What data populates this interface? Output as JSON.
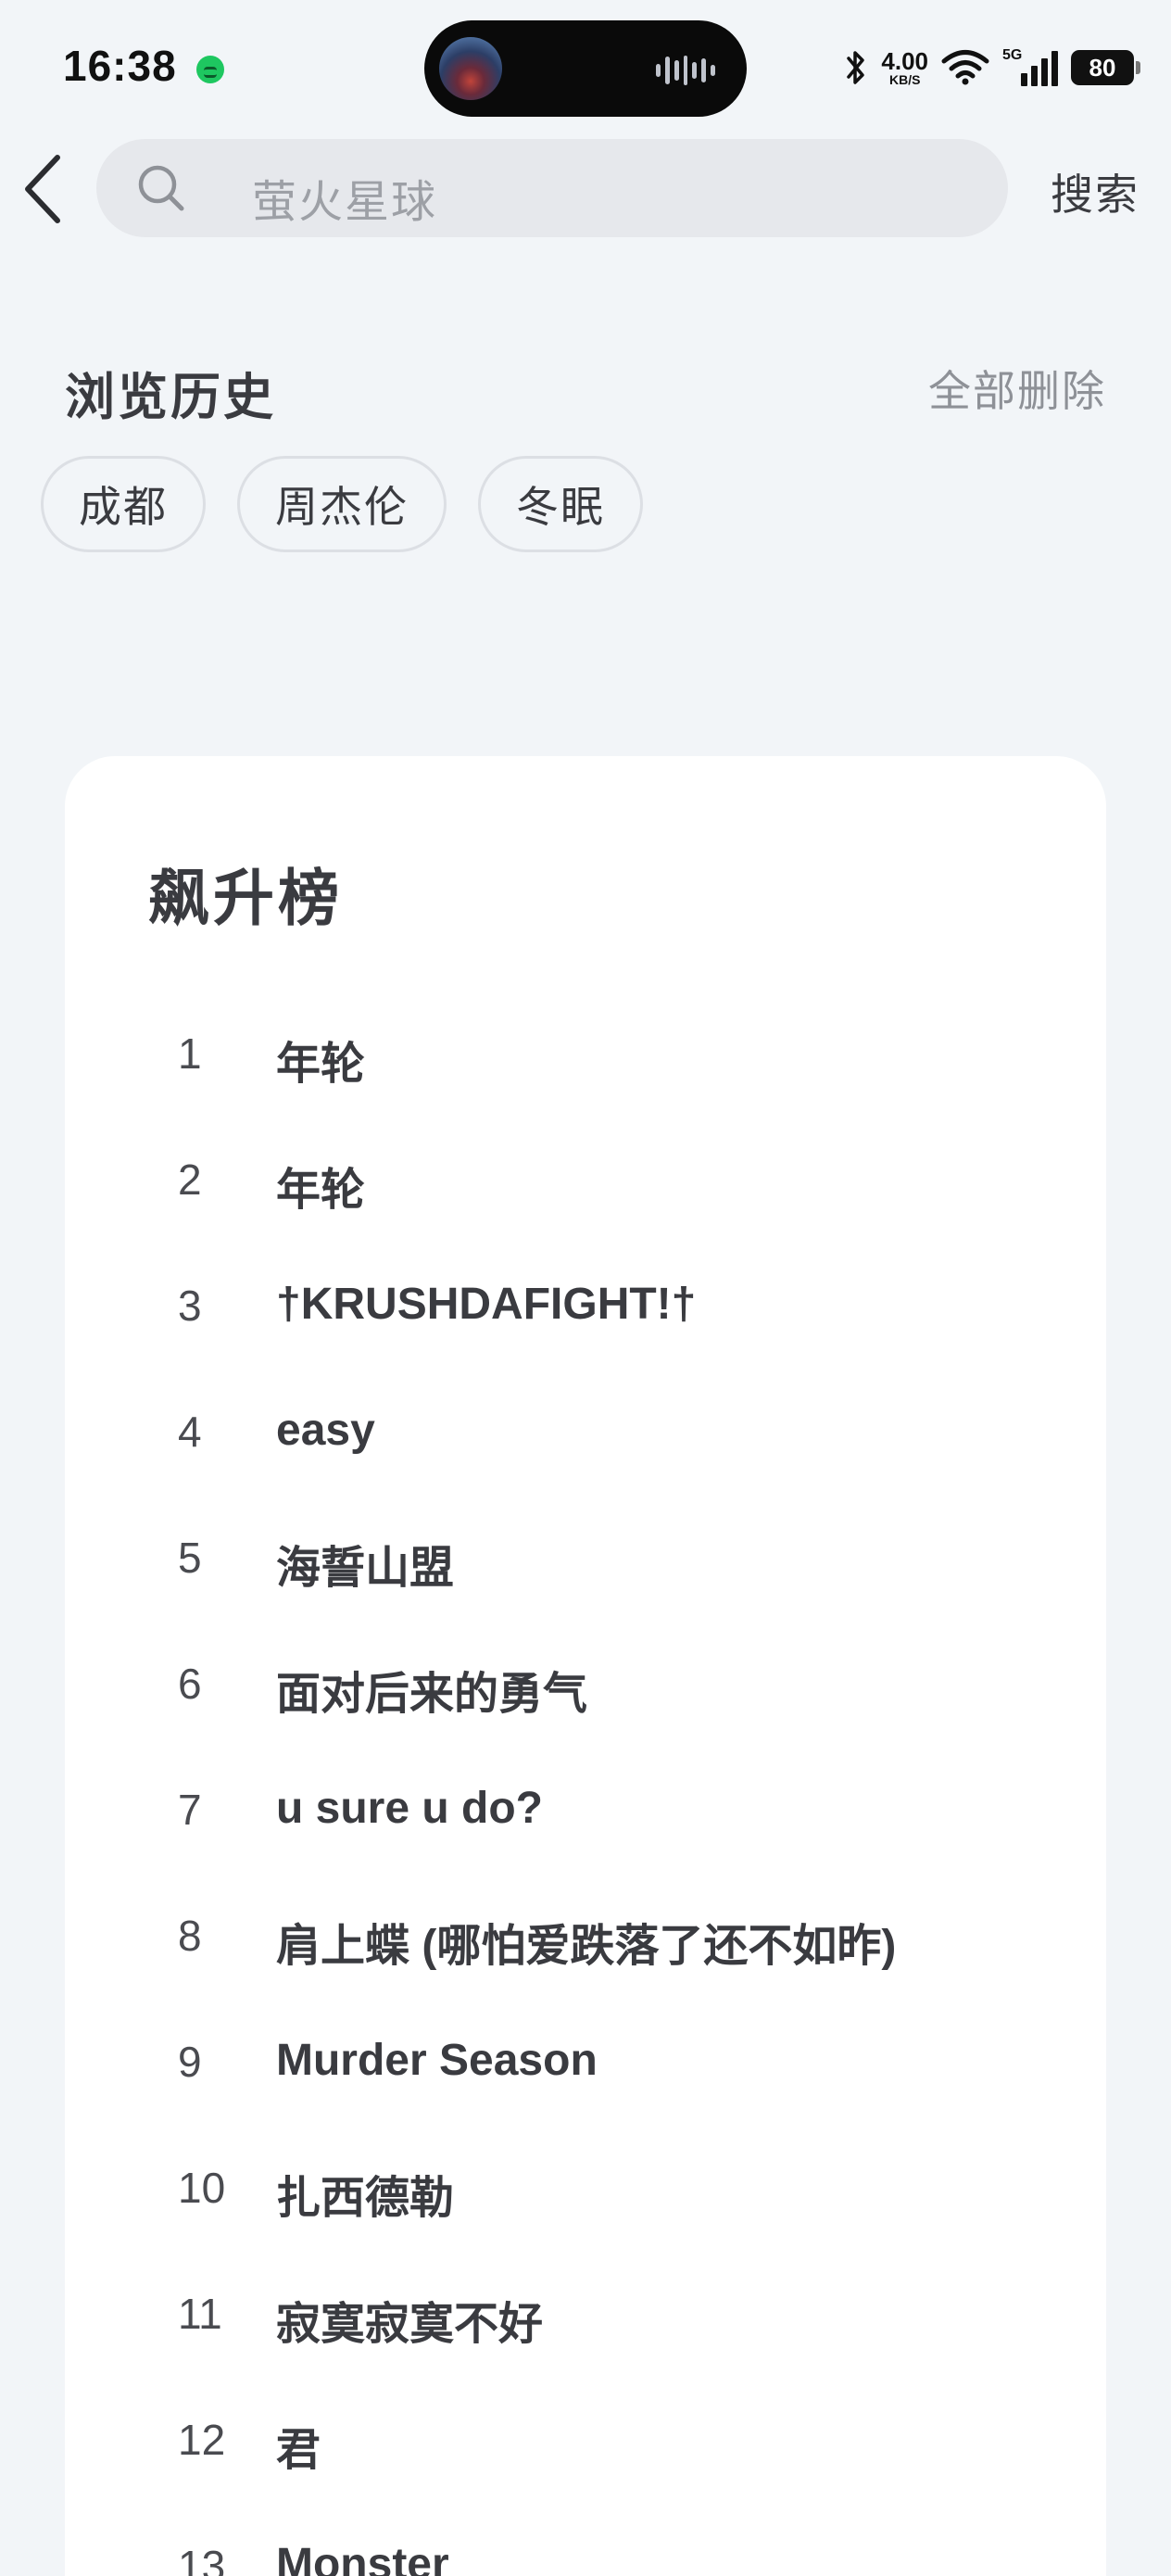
{
  "status_bar": {
    "time": "16:38",
    "net_speed": "4.00",
    "net_speed_unit": "KB/S",
    "signal_type": "5G",
    "battery": "80"
  },
  "search": {
    "placeholder": "萤火星球",
    "button_label": "搜索"
  },
  "history": {
    "title": "浏览历史",
    "clear_label": "全部删除",
    "items": [
      "成都",
      "周杰伦",
      "冬眠"
    ]
  },
  "chart": {
    "title": "飙升榜",
    "items": [
      {
        "rank": "1",
        "name": "年轮"
      },
      {
        "rank": "2",
        "name": "年轮"
      },
      {
        "rank": "3",
        "name": "†KRUSHDAFIGHT!†"
      },
      {
        "rank": "4",
        "name": "easy"
      },
      {
        "rank": "5",
        "name": "海誓山盟"
      },
      {
        "rank": "6",
        "name": "面对后来的勇气"
      },
      {
        "rank": "7",
        "name": "u sure u do?"
      },
      {
        "rank": "8",
        "name": "肩上蝶 (哪怕爱跌落了还不如昨)"
      },
      {
        "rank": "9",
        "name": "Murder Season"
      },
      {
        "rank": "10",
        "name": "扎西德勒"
      },
      {
        "rank": "11",
        "name": "寂寞寂寞不好"
      },
      {
        "rank": "12",
        "name": "君"
      },
      {
        "rank": "13",
        "name": "Monster"
      }
    ]
  },
  "colors": {
    "background": "#f2f5f8",
    "card": "#ffffff",
    "text_primary": "#3a3b40",
    "text_secondary": "#8e9197",
    "notification_green": "#1ec760"
  }
}
